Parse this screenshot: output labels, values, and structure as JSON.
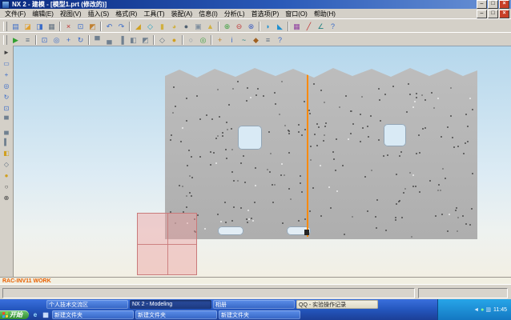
{
  "window": {
    "title": "NX 2 - 建模 - [模型1.prt (修改的)]",
    "minimize": "–",
    "maximize": "□",
    "close": "×"
  },
  "menubar": {
    "items": [
      {
        "label": "文件(F)"
      },
      {
        "label": "编辑(E)"
      },
      {
        "label": "视图(V)"
      },
      {
        "label": "插入(S)"
      },
      {
        "label": "格式(R)"
      },
      {
        "label": "工具(T)"
      },
      {
        "label": "装配(A)"
      },
      {
        "label": "信息(I)"
      },
      {
        "label": "分析(L)"
      },
      {
        "label": "首选项(P)"
      },
      {
        "label": "窗口(O)"
      },
      {
        "label": "帮助(H)"
      }
    ],
    "minimize": "–",
    "restore": "□",
    "close": "×"
  },
  "toolbars": {
    "row1": [
      {
        "name": "new-file-icon",
        "glyph": "▤",
        "color": "#3a6bc8"
      },
      {
        "name": "open-file-icon",
        "glyph": "◪",
        "color": "#e0a030"
      },
      {
        "name": "save-file-icon",
        "glyph": "◨",
        "color": "#3a6bc8"
      },
      {
        "name": "print-icon",
        "glyph": "▦",
        "color": "#607080"
      },
      {
        "sep": true
      },
      {
        "name": "cut-icon",
        "glyph": "×",
        "color": "#c03030"
      },
      {
        "name": "copy-icon",
        "glyph": "⊡",
        "color": "#3a6bc8"
      },
      {
        "name": "paste-icon",
        "glyph": "◩",
        "color": "#c08030"
      },
      {
        "sep": true
      },
      {
        "name": "undo-icon",
        "glyph": "↶",
        "color": "#3a6bc8"
      },
      {
        "name": "redo-icon",
        "glyph": "↷",
        "color": "#3a6bc8"
      },
      {
        "sep": true
      },
      {
        "name": "sketch-icon",
        "glyph": "◢",
        "color": "#d0a020"
      },
      {
        "name": "datum-plane-icon",
        "glyph": "◇",
        "color": "#20a0c0"
      },
      {
        "name": "extrude-icon",
        "glyph": "▮",
        "color": "#d0b040"
      },
      {
        "name": "revolve-icon",
        "glyph": "◕",
        "color": "#d0b040"
      },
      {
        "name": "hole-icon",
        "glyph": "●",
        "color": "#506070"
      },
      {
        "name": "block-icon",
        "glyph": "▣",
        "color": "#8090a0"
      },
      {
        "name": "boss-icon",
        "glyph": "▲",
        "color": "#d0b040"
      },
      {
        "sep": true
      },
      {
        "name": "unite-icon",
        "glyph": "⊕",
        "color": "#40a040"
      },
      {
        "name": "subtract-icon",
        "glyph": "⊖",
        "color": "#c04040"
      },
      {
        "name": "intersect-icon",
        "glyph": "⊗",
        "color": "#4060c0"
      },
      {
        "sep": true
      },
      {
        "name": "edge-blend-icon",
        "glyph": "◗",
        "color": "#2090d0"
      },
      {
        "name": "chamfer-icon",
        "glyph": "◣",
        "color": "#2090d0"
      },
      {
        "sep": true
      },
      {
        "name": "pattern-feature-icon",
        "glyph": "▦",
        "color": "#9040a0"
      },
      {
        "name": "sketch-curve-icon",
        "glyph": "╱",
        "color": "#c03030"
      },
      {
        "name": "measure-icon",
        "glyph": "∠",
        "color": "#208080"
      },
      {
        "name": "help-icon",
        "glyph": "?",
        "color": "#3a6bc8"
      }
    ],
    "row2": [
      {
        "name": "start-app-icon",
        "glyph": "▶",
        "color": "#30a030"
      },
      {
        "name": "layer-settings-icon",
        "glyph": "≡",
        "color": "#607080"
      },
      {
        "sep": true
      },
      {
        "name": "fit-view-icon",
        "glyph": "⊡",
        "color": "#3a6bc8"
      },
      {
        "name": "zoom-icon",
        "glyph": "◎",
        "color": "#3a6bc8"
      },
      {
        "name": "pan-icon",
        "glyph": "+",
        "color": "#3a6bc8"
      },
      {
        "name": "rotate-view-icon",
        "glyph": "↻",
        "color": "#3a6bc8"
      },
      {
        "sep": true
      },
      {
        "name": "front-view-icon",
        "glyph": "▀",
        "color": "#708090"
      },
      {
        "name": "top-view-icon",
        "glyph": "▄",
        "color": "#708090"
      },
      {
        "name": "right-view-icon",
        "glyph": "▐",
        "color": "#708090"
      },
      {
        "name": "isometric-view-icon",
        "glyph": "◧",
        "color": "#708090"
      },
      {
        "name": "trimetric-view-icon",
        "glyph": "◩",
        "color": "#708090"
      },
      {
        "sep": true
      },
      {
        "name": "wireframe-display-icon",
        "glyph": "◇",
        "color": "#607080"
      },
      {
        "name": "shaded-display-icon",
        "glyph": "●",
        "color": "#d0a020"
      },
      {
        "sep": true
      },
      {
        "name": "hide-object-icon",
        "glyph": "○",
        "color": "#8090a0"
      },
      {
        "name": "show-object-icon",
        "glyph": "◎",
        "color": "#40a040"
      },
      {
        "sep": true
      },
      {
        "name": "wcs-dynamics-icon",
        "glyph": "+",
        "color": "#c08020"
      },
      {
        "name": "object-info-icon",
        "glyph": "i",
        "color": "#3a6bc8"
      },
      {
        "name": "analysis-icon",
        "glyph": "~",
        "color": "#208080"
      },
      {
        "name": "snap-point-icon",
        "glyph": "◆",
        "color": "#a06020"
      },
      {
        "name": "preferences-icon",
        "glyph": "≡",
        "color": "#607080"
      },
      {
        "name": "context-help-icon",
        "glyph": "?",
        "color": "#3a6bc8"
      }
    ]
  },
  "left_toolbar": {
    "items": [
      {
        "name": "select-cursor-icon",
        "glyph": "►",
        "color": "#404040"
      },
      {
        "name": "rect-select-icon",
        "glyph": "▭",
        "color": "#3a6bc8"
      },
      {
        "name": "pan-view-icon",
        "glyph": "+",
        "color": "#3a6bc8"
      },
      {
        "name": "zoom-view-icon",
        "glyph": "◎",
        "color": "#3a6bc8"
      },
      {
        "name": "rotate-view-icon",
        "glyph": "↻",
        "color": "#3a6bc8"
      },
      {
        "name": "fit-view-icon",
        "glyph": "⊡",
        "color": "#3a6bc8"
      },
      {
        "name": "front-view-icon",
        "glyph": "▀",
        "color": "#708090"
      },
      {
        "name": "top-view-icon",
        "glyph": "▄",
        "color": "#708090"
      },
      {
        "name": "right-view-icon",
        "glyph": "▌",
        "color": "#708090"
      },
      {
        "name": "iso-view-icon",
        "glyph": "◧",
        "color": "#d0a020"
      },
      {
        "name": "wireframe-mode-icon",
        "glyph": "◇",
        "color": "#607080"
      },
      {
        "name": "shaded-mode-icon",
        "glyph": "●",
        "color": "#d0a020"
      },
      {
        "name": "snap-circle-icon",
        "glyph": "○",
        "color": "#404040"
      },
      {
        "name": "snap-center-icon",
        "glyph": "⊕",
        "color": "#404040"
      }
    ]
  },
  "viewport": {
    "part": {
      "color": "#b4b4b4",
      "hole_pattern": {
        "count": 250,
        "seed": 987654321
      }
    },
    "orange_line_color": "#ff8a00",
    "selection_color": "#efa9a9"
  },
  "prompt_bar": {
    "text": "RAC-INV11 WORK",
    "color": "#e86000"
  },
  "taskbar": {
    "start_label": "开始",
    "quick": [
      {
        "name": "ie-quick-icon",
        "glyph": "e",
        "color": "#9fe0ff"
      },
      {
        "name": "show-desktop-icon",
        "glyph": "▦",
        "color": "#d5e6ff"
      }
    ],
    "tasks_top": [
      {
        "label": "个人技术交流区"
      },
      {
        "label": "NX 2 - Modeling",
        "active": true
      },
      {
        "label": "相册"
      },
      {
        "label": "QQ - 实验操作记录",
        "light": true
      }
    ],
    "tasks_bottom": [
      {
        "label": "新建文件夹"
      },
      {
        "label": "新建文件夹"
      },
      {
        "label": "新建文件夹"
      }
    ],
    "tray": {
      "icons": [
        {
          "name": "volume-icon",
          "glyph": "◄",
          "color": "#d8ecff"
        },
        {
          "name": "antivirus-icon",
          "glyph": "●",
          "color": "#8cff8c"
        },
        {
          "name": "network-icon",
          "glyph": "▥",
          "color": "#d5e6ff"
        }
      ],
      "time": "11:45"
    }
  }
}
